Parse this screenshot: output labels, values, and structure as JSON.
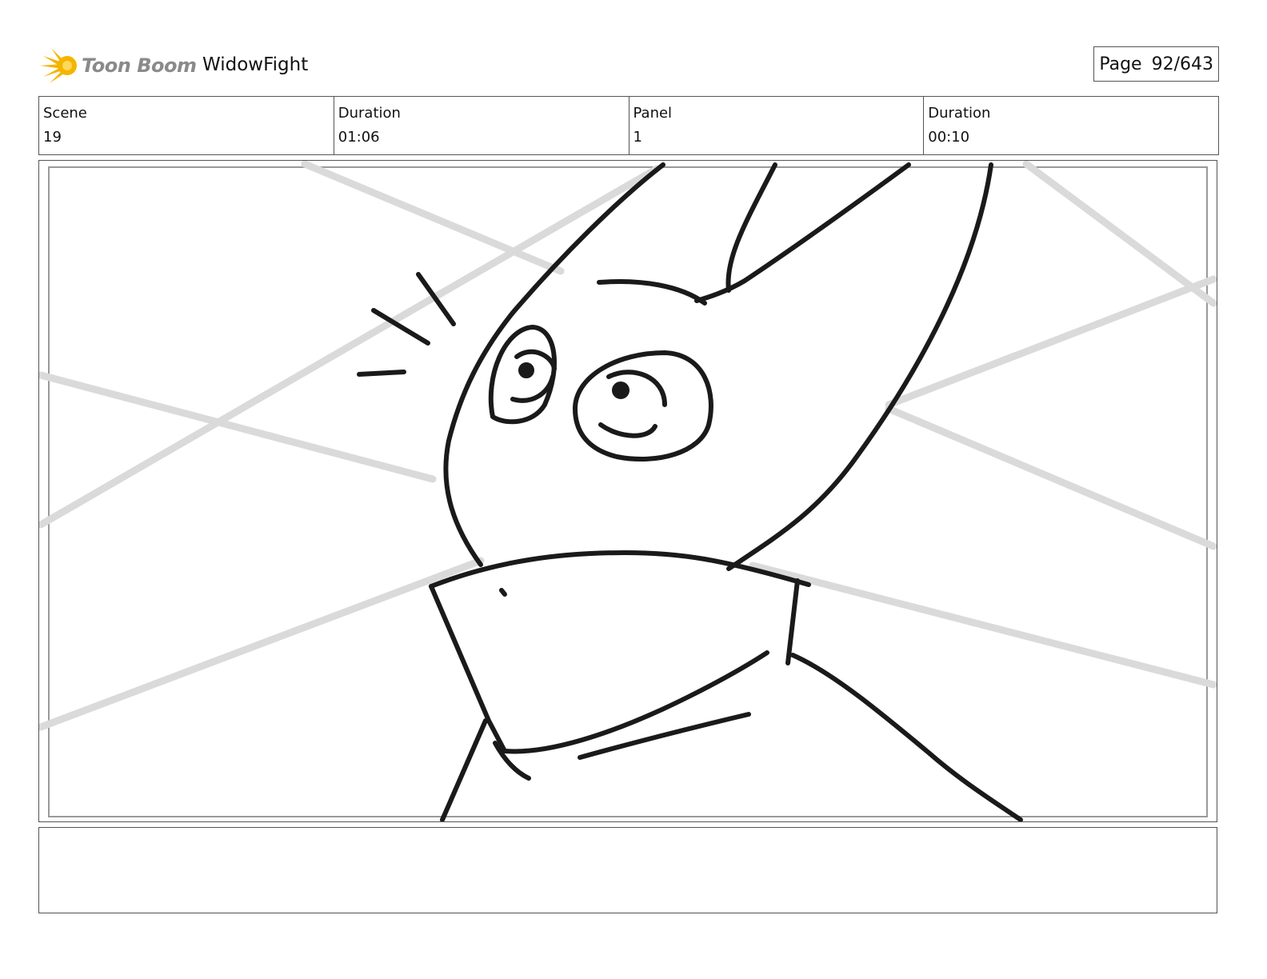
{
  "header": {
    "logo_text": "Toon Boom",
    "project_title": "WidowFight",
    "page_label": "Page",
    "page_value": "92/643"
  },
  "info": {
    "scene_label": "Scene",
    "scene_value": "19",
    "scene_duration_label": "Duration",
    "scene_duration_value": "01:06",
    "panel_label": "Panel",
    "panel_value": "1",
    "panel_duration_label": "Duration",
    "panel_duration_value": "00:10"
  },
  "notes": {
    "text": ""
  },
  "colors": {
    "ink": "#1a1a1a",
    "guide_lines": "#d9d9d9",
    "logo_orange": "#f5b400",
    "border": "#555555"
  }
}
